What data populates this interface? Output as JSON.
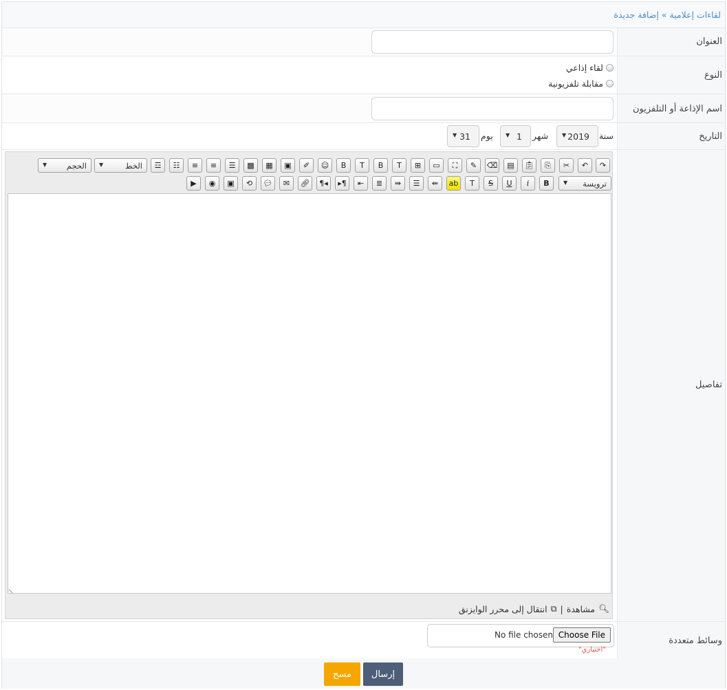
{
  "breadcrumb": {
    "text": "لقاءات إعلامية » إضافة جديدة"
  },
  "form": {
    "title_label": "العنوان",
    "type_label": "النوع",
    "type_options": [
      "لقاء إذاعي",
      "مقابلة تلفزيونية"
    ],
    "station_label": "اسم الإذاعة أو التلفزيون",
    "date_label": "التاريخ",
    "year_label": "سنة",
    "year_value": "2019",
    "month_label": "شهر",
    "month_value": "1",
    "day_label": "يوم",
    "day_value": "31",
    "details_label": "تفاصيل",
    "media_label": "وسائط متعددة",
    "file_button": "Choose File",
    "file_status": "No file chosen",
    "optional_note": "\"اختياري\""
  },
  "editor": {
    "size_select": "الحجم",
    "font_select": "الخط",
    "heading_select": "ترويسة",
    "preview_link": "مشاهدة",
    "separator": "|",
    "wysiwyg_link": "انتقال إلى محرر الوايزنق"
  },
  "actions": {
    "submit": "إرسال",
    "clear": "مسح"
  },
  "colors": {
    "link": "#4a90c6",
    "submit": "#4e5d78",
    "clear": "#f5a700",
    "optional": "#d9534f"
  }
}
